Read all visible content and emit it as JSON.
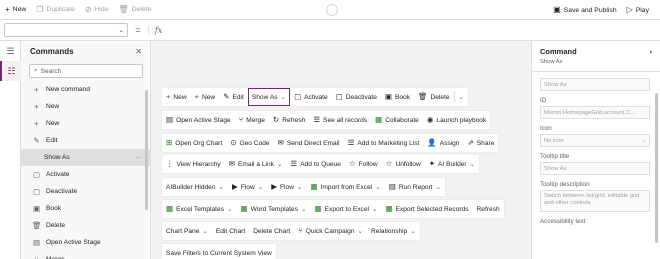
{
  "topbar": {
    "new_label": "New",
    "duplicate_label": "Duplicate",
    "hide_label": "Hide",
    "delete_label": "Delete",
    "save_publish_label": "Save and Publish",
    "play_label": "Play"
  },
  "formula": {
    "eq": "=",
    "fx": "fx"
  },
  "tree": {
    "title": "Commands",
    "search_placeholder": "Search",
    "items": [
      {
        "label": "New command",
        "icon": "+"
      },
      {
        "label": "New",
        "icon": "+"
      },
      {
        "label": "New",
        "icon": "+"
      },
      {
        "label": "Edit",
        "icon": "✎"
      },
      {
        "label": "Show As",
        "icon": ""
      },
      {
        "label": "Activate",
        "icon": "▢"
      },
      {
        "label": "Deactivate",
        "icon": "▢"
      },
      {
        "label": "Book",
        "icon": "▣"
      },
      {
        "label": "Delete",
        "icon": "🗑"
      },
      {
        "label": "Open Active Stage",
        "icon": "▤"
      },
      {
        "label": "Merge",
        "icon": "⑂"
      }
    ]
  },
  "canvas": {
    "rows": [
      [
        {
          "icon": "+",
          "label": "New"
        },
        {
          "icon": "+",
          "label": "New"
        },
        {
          "icon": "✎",
          "label": "Edit"
        },
        {
          "icon": "",
          "label": "Show As",
          "chev": true,
          "sel": true
        },
        {
          "icon": "▢",
          "label": "Activate"
        },
        {
          "icon": "▢",
          "label": "Deactivate"
        },
        {
          "icon": "▣",
          "label": "Book"
        },
        {
          "icon": "🗑",
          "label": "Delete"
        },
        {
          "icon": "",
          "label": "",
          "chev": true,
          "sep": true
        }
      ],
      [
        {
          "icon": "▤",
          "label": "Open Active Stage"
        },
        {
          "icon": "⑂",
          "label": "Merge"
        },
        {
          "icon": "↻",
          "label": "Refresh"
        },
        {
          "icon": "☰",
          "label": "See all records"
        },
        {
          "icon": "▦",
          "label": "Collaborate"
        },
        {
          "icon": "◉",
          "label": "Launch playbook"
        }
      ],
      [
        {
          "icon": "⊞",
          "label": "Open Org Chart"
        },
        {
          "icon": "⊙",
          "label": "Geo Code"
        },
        {
          "icon": "✉",
          "label": "Send Direct Email"
        },
        {
          "icon": "☰",
          "label": "Add to Marketing List"
        },
        {
          "icon": "👤",
          "label": "Assign"
        },
        {
          "icon": "⇗",
          "label": "Share"
        }
      ],
      [
        {
          "icon": "⋮",
          "label": "View Hierarchy"
        },
        {
          "icon": "✉",
          "label": "Email a Link",
          "chev": true
        },
        {
          "icon": "☰",
          "label": "Add to Queue"
        },
        {
          "icon": "☆",
          "label": "Follow"
        },
        {
          "icon": "☆",
          "label": "Unfollow"
        },
        {
          "icon": "✦",
          "label": "AI Builder",
          "chev": true
        }
      ],
      [
        {
          "icon": "",
          "label": "AIBuilder Hidden",
          "chev": true
        },
        {
          "icon": "▶",
          "label": "Flow",
          "chev": true
        },
        {
          "icon": "▶",
          "label": "Flow",
          "chev": true
        },
        {
          "icon": "▦",
          "label": "Import from Excel",
          "chev": true
        },
        {
          "icon": "▤",
          "label": "Run Report",
          "chev": true
        }
      ],
      [
        {
          "icon": "▦",
          "label": "Excel Templates",
          "chev": true
        },
        {
          "icon": "▦",
          "label": "Word Templates",
          "chev": true
        },
        {
          "icon": "▦",
          "label": "Export to Excel",
          "chev": true
        },
        {
          "icon": "▦",
          "label": "Export Selected Records"
        },
        {
          "icon": "",
          "label": "Refresh"
        }
      ],
      [
        {
          "icon": "",
          "label": "Chart Pane",
          "chev": true
        },
        {
          "icon": "",
          "label": "Edit Chart"
        },
        {
          "icon": "",
          "label": "Delete Chart"
        },
        {
          "icon": "⑂",
          "label": "Quick Campaign",
          "chev": true
        },
        {
          "icon": "",
          "label": "Relationship",
          "chev": true
        }
      ],
      [
        {
          "icon": "",
          "label": "Save Filters to Current System View"
        }
      ]
    ]
  },
  "props": {
    "title": "Command",
    "subtitle": "Show As",
    "label_value": "Show As",
    "id_label": "ID",
    "id_value": "Mscrm.HomepageGrid.account.C...",
    "icon_label": "Icon",
    "icon_value": "No icon",
    "tooltip_title_label": "Tooltip title",
    "tooltip_title_value": "Show As",
    "tooltip_desc_label": "Tooltip description",
    "tooltip_desc_value": "Switch between list/grid, editable grid and other controls",
    "accessibility_label": "Accessibility text"
  },
  "colors": {
    "accent": "#742774",
    "green": "#107c10",
    "text": "#242424"
  }
}
